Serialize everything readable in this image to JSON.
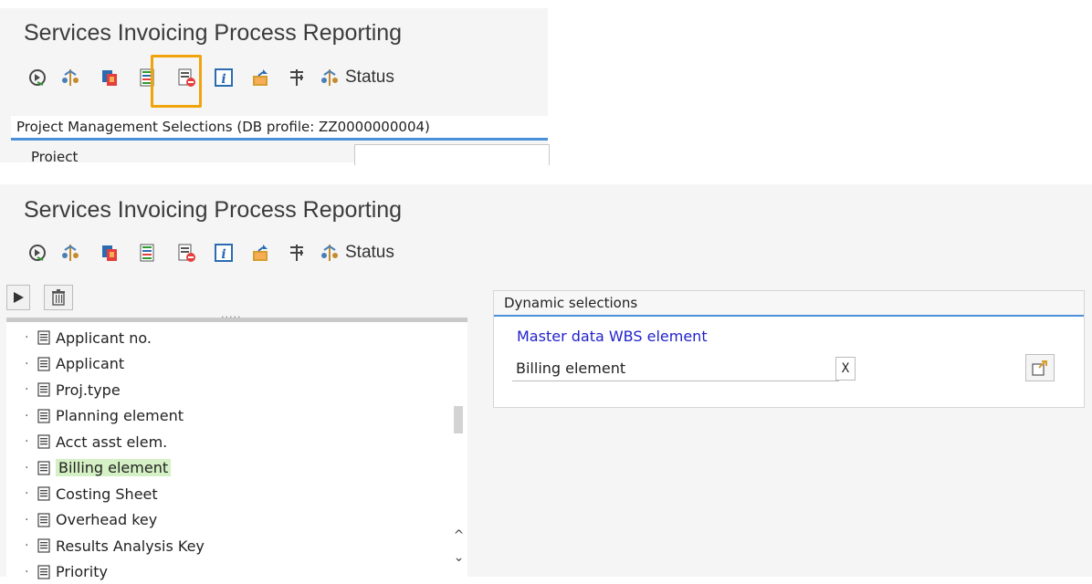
{
  "top": {
    "title": "Services Invoicing Process Reporting",
    "selection_header": "Project Management Selections (DB profile: ZZ0000000004)",
    "cutoff_label": "Project"
  },
  "bottom": {
    "title": "Services Invoicing Process Reporting",
    "tree_items": [
      {
        "label": "Applicant no.",
        "selected": false
      },
      {
        "label": "Applicant",
        "selected": false
      },
      {
        "label": "Proj.type",
        "selected": false
      },
      {
        "label": "Planning element",
        "selected": false
      },
      {
        "label": "Acct asst elem.",
        "selected": false
      },
      {
        "label": "Billing element",
        "selected": true
      },
      {
        "label": "Costing Sheet",
        "selected": false
      },
      {
        "label": "Overhead key",
        "selected": false
      },
      {
        "label": "Results Analysis Key",
        "selected": false
      },
      {
        "label": "Priority",
        "selected": false
      }
    ],
    "dynamic": {
      "header": "Dynamic selections",
      "group_title": "Master data WBS element",
      "field_label": "Billing element",
      "field_value": "X"
    }
  },
  "toolbar": {
    "status_label": "Status",
    "icons": [
      "execute-icon",
      "hierarchy-icon",
      "copy-selections-icon",
      "dynamic-selections-icon",
      "delete-selections-icon",
      "info-icon",
      "export-icon",
      "settings-icon",
      "status-icon"
    ],
    "highlighted_icon": "dynamic-selections-icon",
    "highlight_color": "#f0a30a"
  },
  "colors": {
    "selection_accent": "#4a90d9",
    "selected_item_bg": "#d4f0c4",
    "group_title": "#2222cc"
  }
}
